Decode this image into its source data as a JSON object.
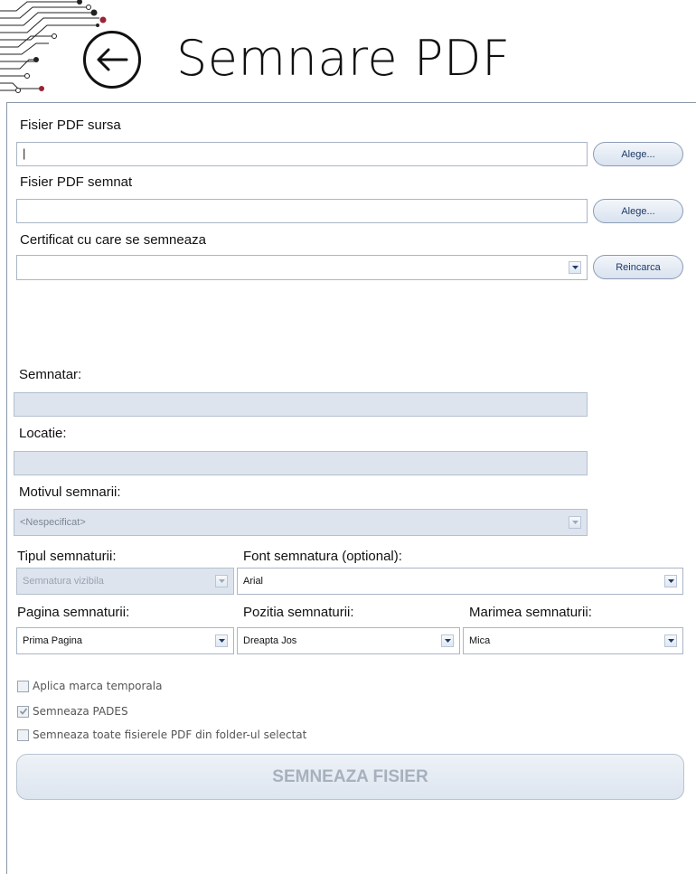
{
  "header": {
    "title": "Semnare PDF",
    "back_icon": "arrow-left-icon"
  },
  "source_pdf": {
    "label": "Fisier PDF sursa",
    "value": "|",
    "button": "Alege..."
  },
  "signed_pdf": {
    "label": "Fisier PDF semnat",
    "value": "",
    "button": "Alege..."
  },
  "certificate": {
    "label": "Certificat cu care se semneaza",
    "value": "",
    "button": "Reincarca"
  },
  "signer": {
    "label": "Semnatar:",
    "value": ""
  },
  "location": {
    "label": "Locatie:",
    "value": ""
  },
  "reason": {
    "label": "Motivul semnarii:",
    "value": "<Nespecificat>"
  },
  "signature_type": {
    "label": "Tipul semnaturii:",
    "value": "Semnatura vizibila"
  },
  "signature_font": {
    "label": "Font semnatura (optional):",
    "value": "Arial"
  },
  "signature_page": {
    "label": "Pagina semnaturii:",
    "value": "Prima Pagina"
  },
  "signature_position": {
    "label": "Pozitia semnaturii:",
    "value": "Dreapta Jos"
  },
  "signature_size": {
    "label": "Marimea semnaturii:",
    "value": "Mica"
  },
  "options": {
    "timestamp": {
      "label": "Aplica marca temporala",
      "checked": false
    },
    "pades": {
      "label": "Semneaza PADES",
      "checked": true
    },
    "all_folder": {
      "label": "Semneaza toate fisierele PDF din folder-ul selectat",
      "checked": false
    }
  },
  "sign_button": "SEMNEAZA FISIER",
  "colors": {
    "accent_dot": "#9b2335",
    "disabled_fill": "#dde4ee",
    "button_text_disabled": "#a7b0bd"
  }
}
